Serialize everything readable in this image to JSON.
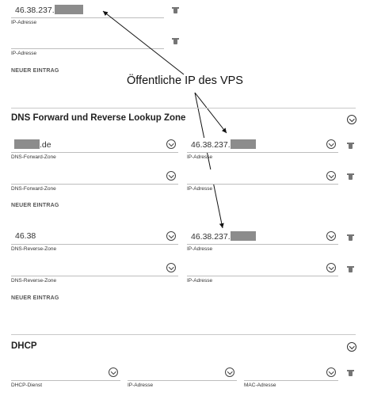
{
  "annotation": {
    "text": "Öffentliche IP des VPS"
  },
  "top_section": {
    "entry1": {
      "value": "46.38.237.",
      "label": "IP-Adresse"
    },
    "entry2": {
      "value": "",
      "label": "IP-Adresse"
    },
    "new_entry": "NEUER EINTRAG"
  },
  "dns": {
    "title": "DNS Forward und Reverse Lookup Zone",
    "forward": {
      "row1": {
        "zone_value": ".de",
        "zone_label": "DNS-Forward-Zone",
        "ip_value": "46.38.237.",
        "ip_label": "IP-Adresse"
      },
      "row2": {
        "zone_value": "",
        "zone_label": "DNS-Forward-Zone",
        "ip_value": "",
        "ip_label": "IP-Adresse"
      },
      "new_entry": "NEUER EINTRAG"
    },
    "reverse": {
      "row1": {
        "zone_value": "46.38",
        "zone_label": "DNS-Reverse-Zone",
        "ip_value": "46.38.237.",
        "ip_label": "IP-Adresse"
      },
      "row2": {
        "zone_value": "",
        "zone_label": "DNS-Reverse-Zone",
        "ip_value": "",
        "ip_label": "IP-Adresse"
      },
      "new_entry": "NEUER EINTRAG"
    }
  },
  "dhcp": {
    "title": "DHCP",
    "row1": {
      "service_label": "DHCP-Dienst",
      "ip_label": "IP-Adresse",
      "mac_label": "MAC-Adresse"
    }
  },
  "icons": [
    "trash-icon",
    "chevron-down-icon",
    "collapse-chevron-icon"
  ]
}
